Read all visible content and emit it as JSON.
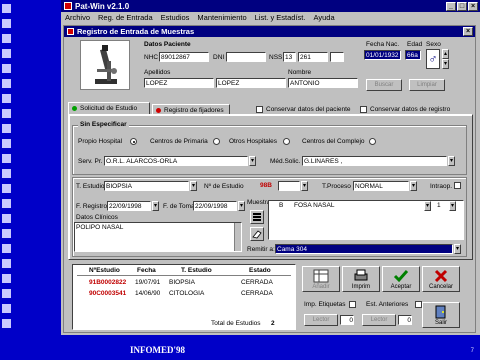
{
  "app": {
    "title": "Pat-Win v2.1.0",
    "menu": [
      "Archivo",
      "Reg. de Entrada",
      "Estudios",
      "Mantenimiento",
      "List. y Estadíst.",
      "Ayuda"
    ],
    "buttons": [
      "_",
      "□",
      "×"
    ]
  },
  "dialog": {
    "title": "Registro de Entrada de Muestras",
    "close": "×"
  },
  "patient": {
    "section_title": "Datos Paciente",
    "nhc_label": "NHC",
    "nhc_value": "89012867",
    "dni_label": "DNI",
    "dni_value": "",
    "nss_label": "NSS",
    "nss_part1": "13",
    "nss_part2": "261",
    "nss_part3": "",
    "apellidos_label": "Apellidos",
    "apellido1": "LOPEZ",
    "apellido2": "LOPEZ",
    "nombre_label": "Nombre",
    "nombre": "ANTONIO",
    "fecha_nac_label": "Fecha Nac.",
    "fecha_nac": "01/01/1932",
    "edad_label": "Edad",
    "edad": "66a",
    "sexo_label": "Sexo",
    "buscar": "Buscar",
    "limpiar": "Limpiar"
  },
  "tabs": {
    "tab1": "Solicitud de Estudio",
    "tab2": "Registro de fijadores",
    "chk_paciente": "Conservar datos del paciente",
    "chk_registro": "Conservar datos de registro"
  },
  "request": {
    "group_title": "Sin Especificar",
    "procedencia_label": "Propio Hospital",
    "radio1": "Centros de Primaria",
    "radio2": "Otros Hospitales",
    "radio3": "Centros del Complejo",
    "serv_label": "Serv. Pr.",
    "serv_value": "O.R.L. ALARCOS-ORLA",
    "medico_label": "Méd.Solic.",
    "medico_value": "G.LINARES ,"
  },
  "study": {
    "tipo_label": "T. Estudio",
    "tipo_value": "BIOPSIA",
    "num_label": "Nº de Estudio",
    "num_prefix": "98B",
    "num_value": "",
    "proceso_label": "T.Proceso",
    "proceso_value": "NORMAL",
    "intraop_label": "Intraop.",
    "registro_label": "F. Registro",
    "registro_value": "22/09/1998",
    "toma_label": "F. de Toma",
    "toma_value": "22/09/1998",
    "clinicos_label": "Datos Clínicos",
    "clinicos_value": "POLIPO NASAL",
    "muestras_label": "Muestras",
    "muestra_code": "B",
    "muestra_value": "FOSA NASAL",
    "muestra_count": "1",
    "remitir_label": "Remitir a:",
    "remitir_value": "Cama 304"
  },
  "history": {
    "headers": [
      "NºEstudio",
      "Fecha",
      "T. Estudio",
      "Estado"
    ],
    "rows": [
      {
        "num": "91B0002822",
        "fecha": "19/07/91",
        "tipo": "BIOPSIA",
        "estado": "CERRADA"
      },
      {
        "num": "90C0003541",
        "fecha": "14/06/90",
        "tipo": "CITOLOGIA",
        "estado": "CERRADA"
      }
    ],
    "total_label": "Total de Estudios",
    "total_value": "2"
  },
  "actions": {
    "anadir": "Añadir",
    "imprimir": "Imprim",
    "aceptar": "Aceptar",
    "cancelar": "Cancelar",
    "etiquetas_label": "Imp. Etiquetas",
    "anteriores_label": "Est. Anteriores",
    "b1": "Lector",
    "b1_count": "0",
    "b2": "Lector",
    "b2_count": "0",
    "salir": "Salir"
  },
  "slide": {
    "footer": "INFOMED'98",
    "page": "7"
  }
}
